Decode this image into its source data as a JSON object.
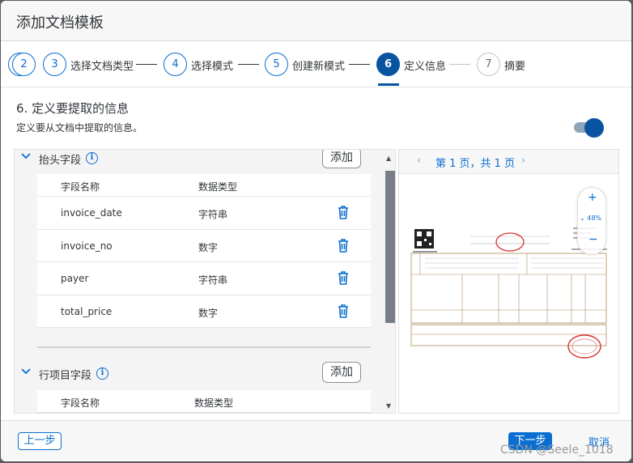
{
  "dialog": {
    "title": "添加文档模板"
  },
  "steps": [
    {
      "num": "2",
      "label": ""
    },
    {
      "num": "3",
      "label": "选择文档类型"
    },
    {
      "num": "4",
      "label": "选择模式"
    },
    {
      "num": "5",
      "label": "创建新模式"
    },
    {
      "num": "6",
      "label": "定义信息"
    },
    {
      "num": "7",
      "label": "摘要"
    }
  ],
  "section": {
    "title": "6. 定义要提取的信息",
    "description": "定义要从文档中提取的信息。",
    "toggle_on": true
  },
  "header_fields": {
    "title": "抬头字段",
    "add_label": "添加",
    "columns": {
      "name": "字段名称",
      "type": "数据类型"
    },
    "rows": [
      {
        "name": "invoice_date",
        "type": "字符串"
      },
      {
        "name": "invoice_no",
        "type": "数字"
      },
      {
        "name": "payer",
        "type": "字符串"
      },
      {
        "name": "total_price",
        "type": "数字"
      }
    ]
  },
  "line_item_fields": {
    "title": "行项目字段",
    "add_label": "添加",
    "columns": {
      "name": "字段名称",
      "type": "数据类型"
    }
  },
  "preview": {
    "page_text": "第 1 页，共 1 页",
    "zoom_plus": "+",
    "zoom_level": "48%",
    "zoom_minus": "−"
  },
  "footer": {
    "prev_label": "上一步",
    "next_label": "下一步",
    "cancel_label": "取消",
    "watermark": "CSDN @Seele_1018"
  },
  "colors": {
    "accent": "#0a6ed1",
    "active": "#0854a0"
  }
}
